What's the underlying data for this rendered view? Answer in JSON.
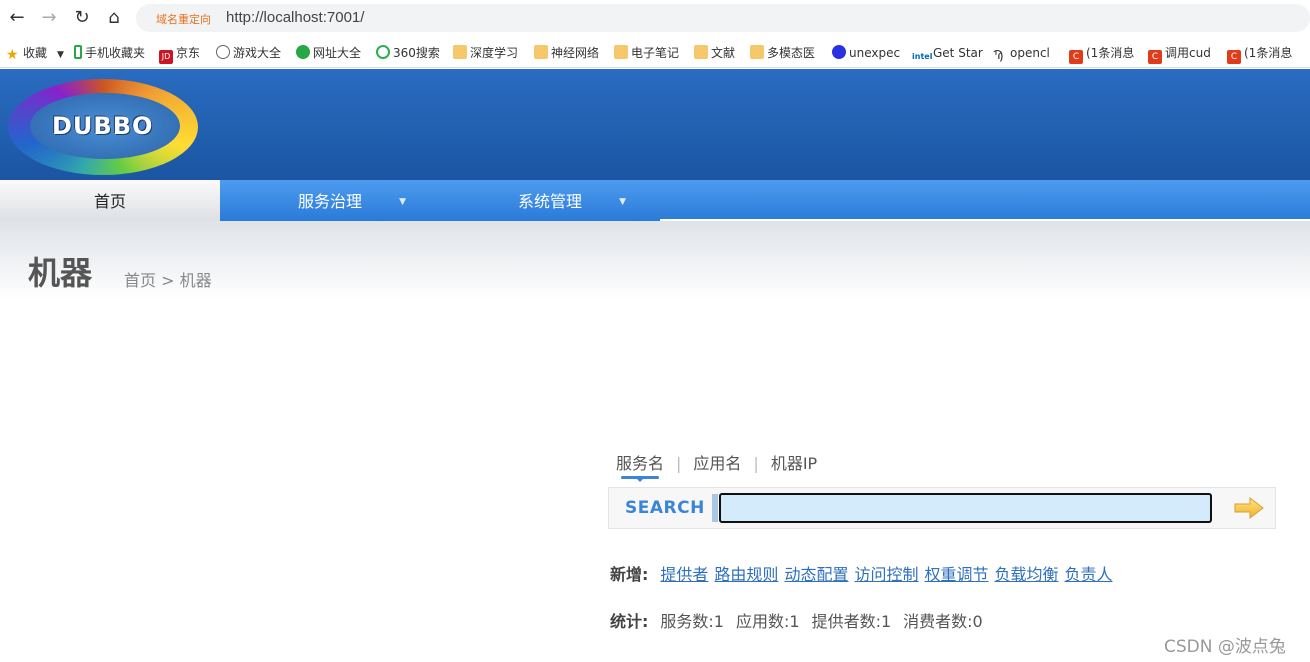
{
  "browser": {
    "redirect_tag": "域名重定向",
    "url": "http://localhost:7001/"
  },
  "bookmarks": [
    {
      "label": "收藏",
      "icon": "star-icon"
    },
    {
      "label": "手机收藏夹",
      "icon": "phone-icon"
    },
    {
      "label": "京东",
      "icon": "jd-icon"
    },
    {
      "label": "游戏大全",
      "icon": "globe-icon"
    },
    {
      "label": "网址大全",
      "icon": "site-nav-icon"
    },
    {
      "label": "360搜索",
      "icon": "search-360-icon"
    },
    {
      "label": "深度学习",
      "icon": "folder-icon"
    },
    {
      "label": "神经网络",
      "icon": "folder-icon"
    },
    {
      "label": "电子笔记",
      "icon": "folder-icon"
    },
    {
      "label": "文献",
      "icon": "folder-icon"
    },
    {
      "label": "多模态医",
      "icon": "folder-icon"
    },
    {
      "label": "unexpec",
      "icon": "baidu-icon"
    },
    {
      "label": "Get Star",
      "icon": "intel-icon"
    },
    {
      "label": "opencl",
      "icon": "opencl-icon"
    },
    {
      "label": "(1条消息",
      "icon": "csdn-icon"
    },
    {
      "label": "调用cud",
      "icon": "csdn-icon"
    },
    {
      "label": "(1条消息",
      "icon": "csdn-icon"
    }
  ],
  "logo_text": "DUBBO",
  "menu": {
    "home": "首页",
    "service_governance": "服务治理",
    "system_management": "系统管理"
  },
  "page": {
    "title": "机器",
    "breadcrumb": "首页 > 机器"
  },
  "search": {
    "tabs": [
      "服务名",
      "应用名",
      "机器IP"
    ],
    "label": "SEARCH",
    "input_value": ""
  },
  "add_row": {
    "label": "新增:",
    "links": [
      "提供者",
      "路由规则",
      "动态配置",
      "访问控制",
      "权重调节",
      "负载均衡",
      "负责人"
    ]
  },
  "stats_row": {
    "label": "统计:",
    "items": [
      "服务数:1",
      "应用数:1",
      "提供者数:1",
      "消费者数:0"
    ]
  },
  "watermark": "CSDN @波点兔",
  "colors": {
    "banner": "#2a6cc0",
    "menu": "#2a7ad8",
    "link": "#2f6fbf",
    "search_accent": "#3a85d8"
  }
}
